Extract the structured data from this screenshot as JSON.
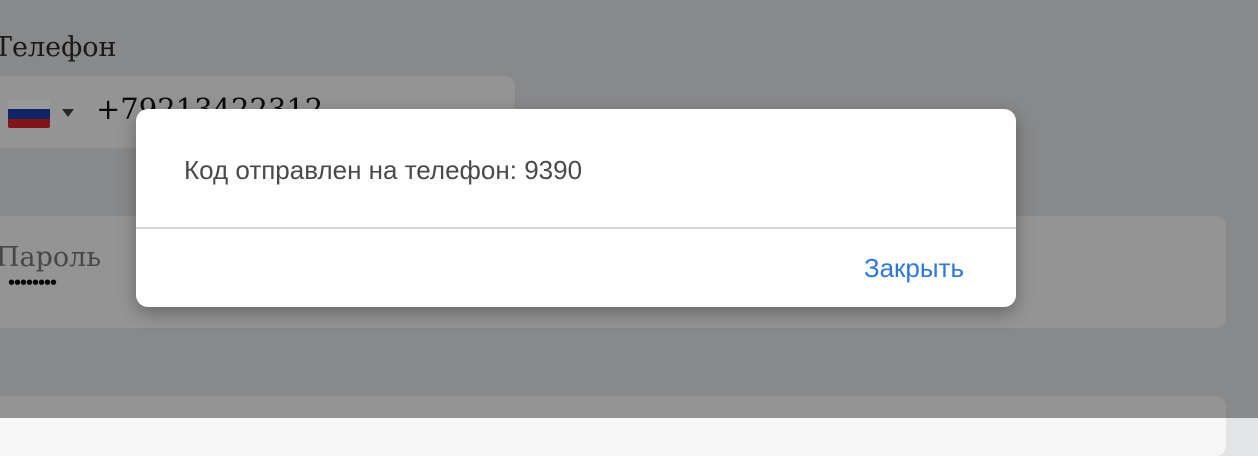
{
  "form": {
    "phone": {
      "label": "Телефон",
      "country_flag": "russia-flag-icon",
      "value": "+79213422312"
    },
    "password": {
      "label": "Пароль",
      "value": "••••••••"
    }
  },
  "dialog": {
    "message": "Код отправлен на телефон: 9390",
    "close_label": "Закрыть"
  },
  "colors": {
    "overlay": "rgba(0,0,0,0.40)",
    "dialog_background": "#ffffff",
    "accent_link": "#2f76dd",
    "message_text": "#4a4a4a",
    "divider": "#d6d6d6",
    "field_background": "#f7f7f7"
  }
}
